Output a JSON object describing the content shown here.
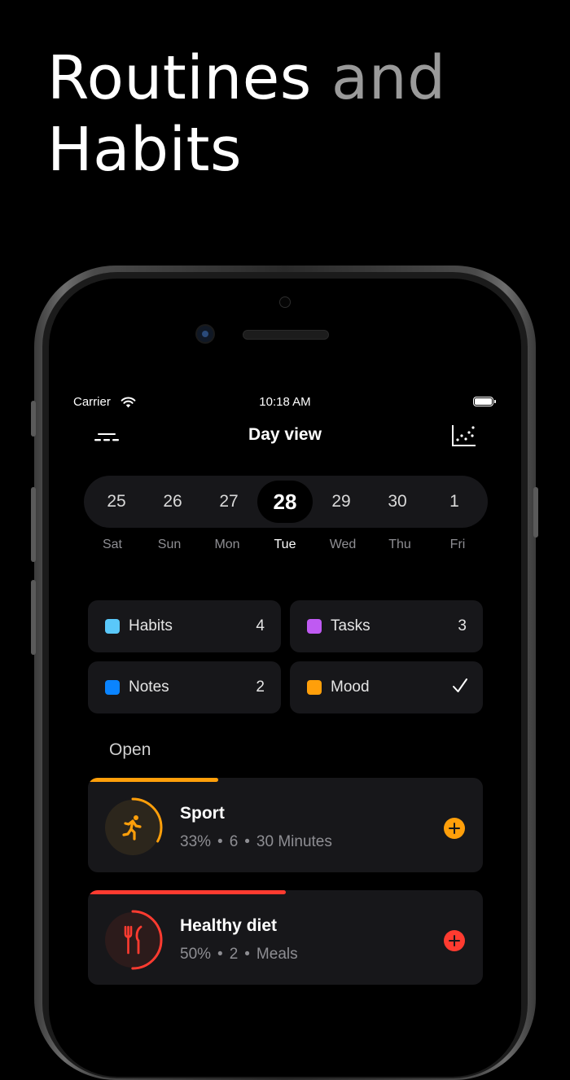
{
  "headline": {
    "bright": "Routines",
    "dim": "and",
    "line2": "Habits"
  },
  "status": {
    "carrier": "Carrier",
    "time": "10:18 AM"
  },
  "nav": {
    "title": "Day view"
  },
  "week": {
    "days": [
      {
        "num": "25",
        "name": "Sat"
      },
      {
        "num": "26",
        "name": "Sun"
      },
      {
        "num": "27",
        "name": "Mon"
      },
      {
        "num": "28",
        "name": "Tue"
      },
      {
        "num": "29",
        "name": "Wed"
      },
      {
        "num": "30",
        "name": "Thu"
      },
      {
        "num": "1",
        "name": "Fri"
      }
    ],
    "selected": "28"
  },
  "summary": {
    "habits": {
      "label": "Habits",
      "count": "4",
      "color": "#5ac8fa"
    },
    "tasks": {
      "label": "Tasks",
      "count": "3",
      "color": "#bf5af2"
    },
    "notes": {
      "label": "Notes",
      "count": "2",
      "color": "#0a84ff"
    },
    "mood": {
      "label": "Mood",
      "done": true,
      "color": "#ff9f0a"
    }
  },
  "section": {
    "open": "Open"
  },
  "habits": [
    {
      "name": "Sport",
      "percent": "33%",
      "count": "6",
      "unit": "30 Minutes",
      "progress": 0.33,
      "color": "#ff9f0a",
      "ring_bg": "#2c261c",
      "icon": "running-person-icon"
    },
    {
      "name": "Healthy diet",
      "percent": "50%",
      "count": "2",
      "unit": "Meals",
      "progress": 0.5,
      "color": "#ff3b30",
      "ring_bg": "#2c1b1b",
      "icon": "fork-knife-icon"
    }
  ],
  "colors": {
    "accent_orange": "#ff9f0a",
    "accent_red": "#ff3b30",
    "card_bg": "#17171a"
  }
}
